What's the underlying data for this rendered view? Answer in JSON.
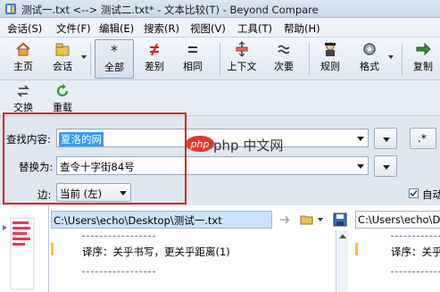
{
  "window": {
    "title": "测试一.txt <--> 测试二.txt* - 文本比较(T) - Beyond Compare"
  },
  "menu": [
    "会话(S)",
    "文件(F)",
    "编辑(E)",
    "搜索(R)",
    "视图(V)",
    "工具(T)",
    "帮助(H)"
  ],
  "toolbar": {
    "home": "主页",
    "sessions": "会话",
    "all": "全部",
    "diffs": "差别",
    "same": "相同",
    "context": "上下文",
    "minor": "次要",
    "rules": "规则",
    "format": "格式",
    "copy": "复制"
  },
  "toolbar2": {
    "swap": "交换",
    "reload": "重载"
  },
  "find": {
    "find_label": "查找内容:",
    "find_value": "夏洛的网",
    "replace_label": "替换为:",
    "replace_value": "查令十字街84号",
    "side_label": "边:",
    "side_value": "当前 (左)",
    "regex_btn": ".*",
    "auto_label": "自动"
  },
  "watermark": "php 中文网",
  "left_pane": {
    "path": "C:\\Users\\echo\\Desktop\\测试一.txt",
    "line1": "译序：关乎书写，更关乎距离(1)"
  },
  "right_pane": {
    "path": "C:\\Users\\echo\\D",
    "line1": "译序：关乎"
  },
  "colors": {
    "red_box": "#e02020",
    "selection": "#3399ff",
    "marker": "#3a7bd5"
  }
}
